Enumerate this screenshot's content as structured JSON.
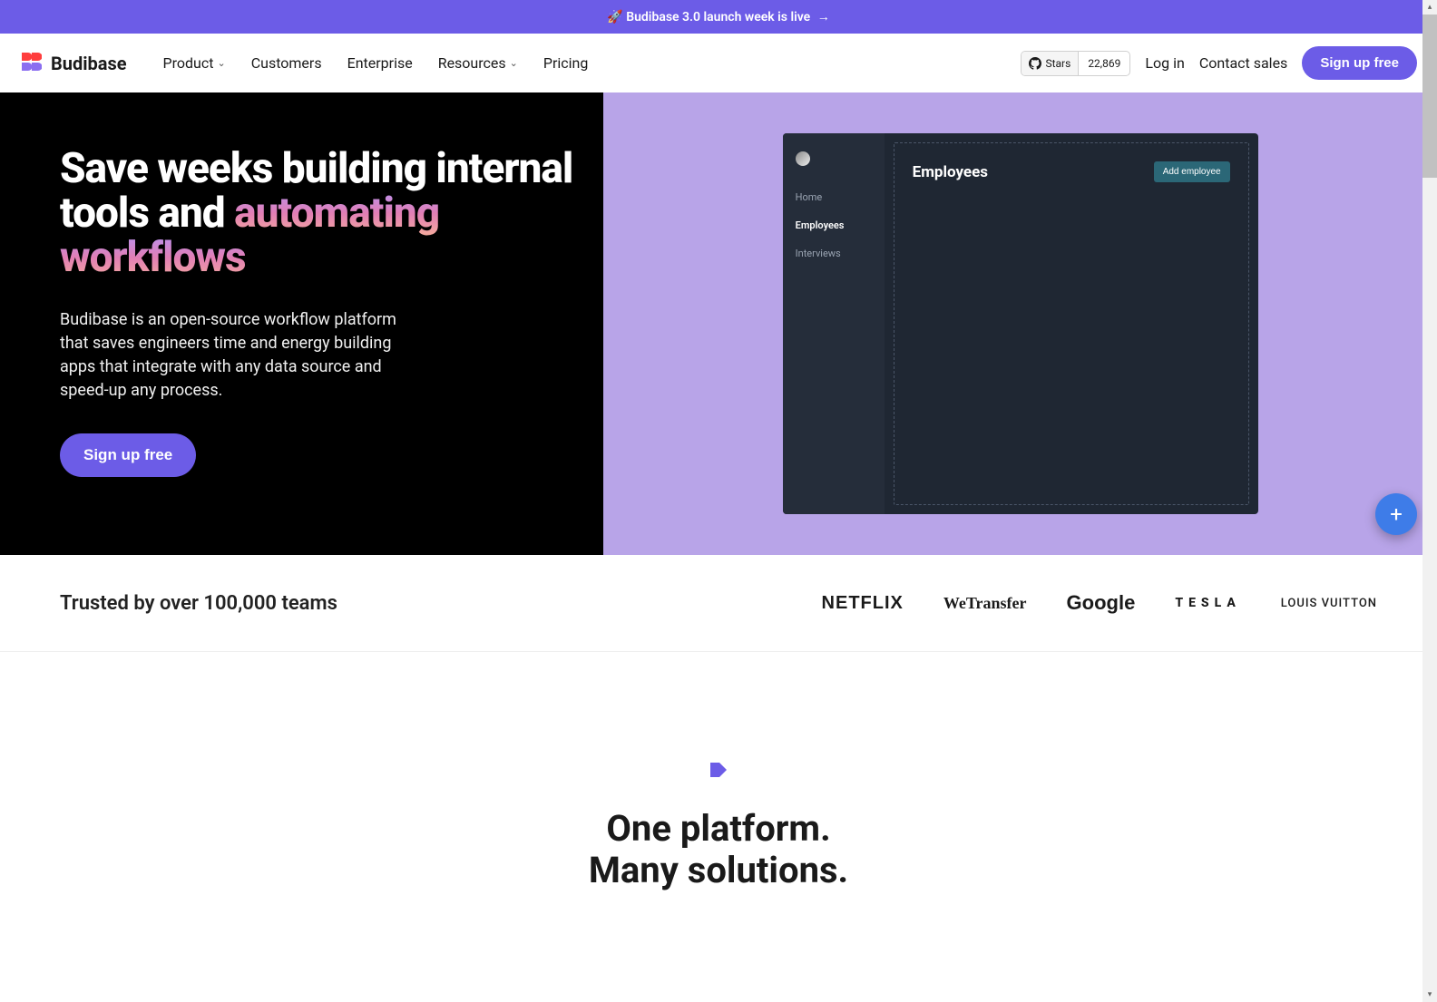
{
  "announcement": {
    "emoji": "🚀",
    "text": "Budibase 3.0 launch week is live",
    "arrow": "→"
  },
  "brand": {
    "name": "Budibase"
  },
  "nav": {
    "items": [
      {
        "label": "Product",
        "dropdown": true
      },
      {
        "label": "Customers",
        "dropdown": false
      },
      {
        "label": "Enterprise",
        "dropdown": false
      },
      {
        "label": "Resources",
        "dropdown": true
      },
      {
        "label": "Pricing",
        "dropdown": false
      }
    ]
  },
  "github": {
    "stars_label": "Stars",
    "count": "22,869"
  },
  "auth": {
    "login": "Log in",
    "contact": "Contact sales",
    "signup": "Sign up free"
  },
  "hero": {
    "title_plain": "Save weeks building internal tools and",
    "title_gradient": "automating workflows",
    "subtitle": "Budibase is an open-source workflow platform that saves engineers time and energy building apps that integrate with any data source and speed-up any process.",
    "cta": "Sign up free"
  },
  "demo": {
    "side_items": [
      {
        "label": "Home",
        "active": false
      },
      {
        "label": "Employees",
        "active": true
      },
      {
        "label": "Interviews",
        "active": false
      }
    ],
    "page_title": "Employees",
    "add_btn": "Add employee"
  },
  "trusted": {
    "text": "Trusted by over 100,000 teams",
    "logos": [
      "NETFLIX",
      "WeTransfer",
      "Google",
      "TESLA",
      "LOUIS VUITTON"
    ]
  },
  "platform": {
    "line1": "One platform.",
    "line2": "Many solutions."
  }
}
